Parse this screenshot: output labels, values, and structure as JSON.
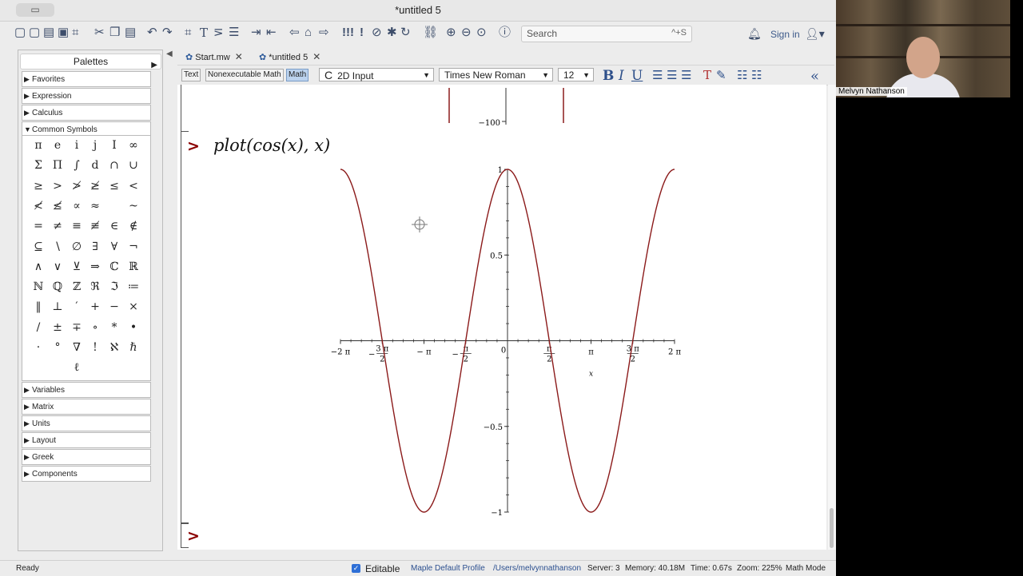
{
  "window": {
    "title": "*untitled 5",
    "sidebar_toggle": "▭"
  },
  "toolbar": {
    "search_placeholder": "Search",
    "search_shortcut": "^+S",
    "sign_in": "Sign in",
    "icons": [
      "new-doc-icon",
      "new-doc2-icon",
      "open-icon",
      "save-icon",
      "save-as-icon",
      "print-icon",
      "cut-icon",
      "copy-icon",
      "paste-icon",
      "undo-icon",
      "redo-icon",
      "text-icon",
      "math-text-icon",
      "execute-icon",
      "indent-icon",
      "outdent-icon",
      "back-icon",
      "home-icon",
      "forward-icon",
      "execute-all-icon",
      "execute-one-icon",
      "stop-icon",
      "debug-icon",
      "restart-icon",
      "link-icon",
      "zoom-in-icon",
      "zoom-out-icon",
      "zoom-reset-icon",
      "help-icon"
    ]
  },
  "palettes": {
    "title": "Palettes",
    "sections_top": [
      "Favorites",
      "Expression",
      "Calculus",
      "Common Symbols"
    ],
    "sections_bottom": [
      "Variables",
      "Matrix",
      "Units",
      "Layout",
      "Greek",
      "Components"
    ],
    "symbols": [
      [
        "π",
        "e",
        "i",
        "j",
        "I",
        "∞"
      ],
      [
        "Σ",
        "Π",
        "∫",
        "d",
        "∩",
        "∪"
      ],
      [
        "≥",
        ">",
        "≯",
        "≱",
        "≤",
        "<"
      ],
      [
        "≮",
        "≰",
        "∝",
        "≈",
        "",
        "~"
      ],
      [
        "=",
        "≠",
        "≡",
        "≢",
        "∈",
        "∉"
      ],
      [
        "⊆",
        "∖",
        "∅",
        "∃",
        "∀",
        "¬"
      ],
      [
        "∧",
        "∨",
        "⊻",
        "⇒",
        "ℂ",
        "ℝ"
      ],
      [
        "ℕ",
        "ℚ",
        "ℤ",
        "ℜ",
        "ℑ",
        "≔"
      ],
      [
        "‖",
        "⊥",
        "′",
        "+",
        "−",
        "×"
      ],
      [
        "/",
        "±",
        "∓",
        "∘",
        "*",
        "•"
      ],
      [
        "·",
        "°",
        "∇",
        "!",
        "ℵ",
        "ℏ"
      ],
      [
        "",
        "",
        "ℓ",
        "",
        "",
        ""
      ]
    ]
  },
  "tabs": [
    {
      "label": "Start.mw"
    },
    {
      "label": "*untitled 5"
    }
  ],
  "format_bar": {
    "modes": [
      "Text",
      "Nonexecutable Math",
      "Math"
    ],
    "input_style": "2D Input",
    "input_style_prefix": "C",
    "font": "Times New Roman",
    "size": "12",
    "bold": "B",
    "italic": "I",
    "underline": "U"
  },
  "worksheet": {
    "prev_tick": "−100",
    "prompt": ">",
    "command": "plot(cos(x), x)"
  },
  "chart_data": {
    "type": "line",
    "function": "cos(x)",
    "xlim": [
      -6.2832,
      6.2832
    ],
    "ylim": [
      -1,
      1
    ],
    "xlabel": "x",
    "ylabel": "",
    "x_ticks": [
      {
        "value": -6.2832,
        "label": "−2 π"
      },
      {
        "value": -4.7124,
        "label": "3 π / 2",
        "neg": true
      },
      {
        "value": -3.1416,
        "label": "− π"
      },
      {
        "value": -1.5708,
        "label": "π / 2",
        "neg": true
      },
      {
        "value": 1.5708,
        "label": "π / 2"
      },
      {
        "value": 3.1416,
        "label": "π"
      },
      {
        "value": 4.7124,
        "label": "3 π / 2"
      },
      {
        "value": 6.2832,
        "label": "2 π"
      }
    ],
    "y_ticks": [
      {
        "value": 1,
        "label": "1"
      },
      {
        "value": 0.5,
        "label": "0.5"
      },
      {
        "value": -0.5,
        "label": "−0.5"
      },
      {
        "value": -1,
        "label": "−1"
      }
    ],
    "origin_label": "0",
    "series": [
      {
        "color": "#8b1a1a"
      }
    ],
    "grid": false
  },
  "statusbar": {
    "ready": "Ready",
    "editable": "Editable",
    "profile": "Maple Default Profile",
    "path": "/Users/melvynnathanson",
    "server": "Server: 3",
    "memory": "Memory: 40.18M",
    "time": "Time: 0.67s",
    "zoom": "Zoom: 225%",
    "mode": "Math Mode"
  },
  "webcam": {
    "name": "Melvyn Nathanson"
  }
}
